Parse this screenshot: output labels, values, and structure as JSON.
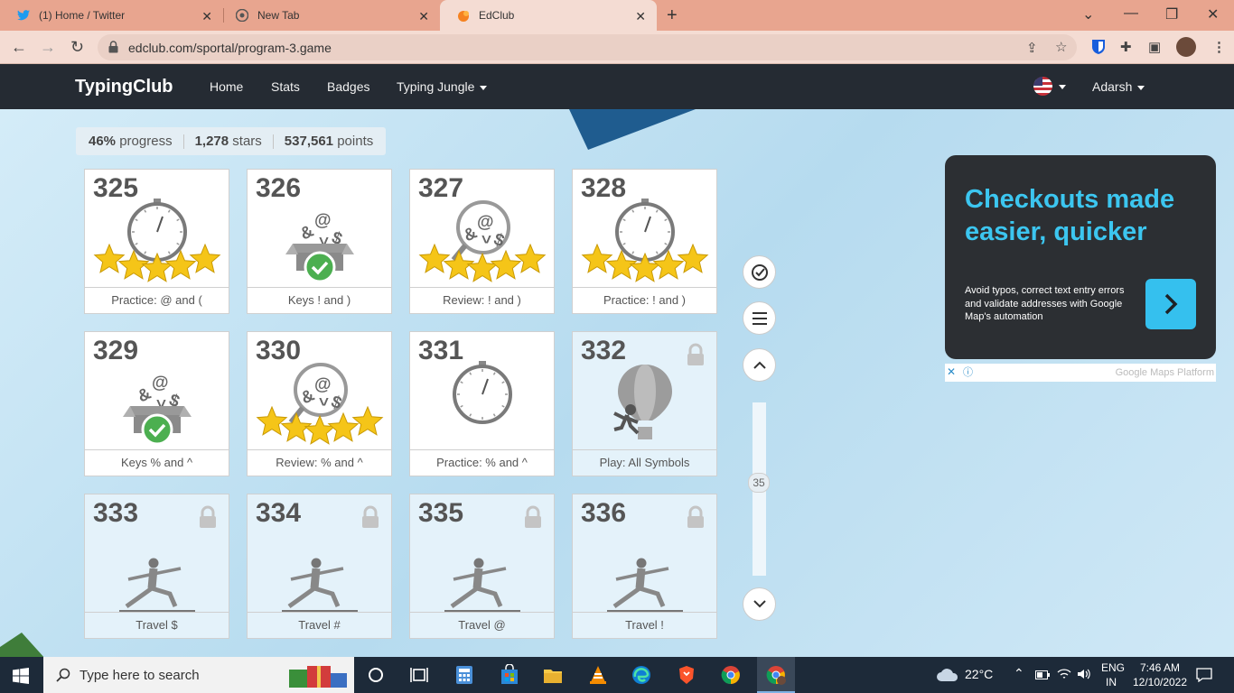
{
  "browser": {
    "tabs": [
      {
        "title": "(1) Home / Twitter",
        "icon": "twitter-icon"
      },
      {
        "title": "New Tab",
        "icon": "chrome-icon"
      },
      {
        "title": "EdClub",
        "icon": "edclub-icon"
      }
    ],
    "url": "edclub.com/sportal/program-3.game"
  },
  "site_nav": {
    "logo": "TypingClub",
    "links": [
      "Home",
      "Stats",
      "Badges",
      "Typing Jungle"
    ],
    "user": "Adarsh"
  },
  "progress": {
    "percent": "46%",
    "percent_label": "progress",
    "stars": "1,278",
    "stars_label": "stars",
    "points": "537,561",
    "points_label": "points"
  },
  "lessons": [
    {
      "num": "325",
      "title": "Practice: @ and (",
      "type": "timer",
      "stars": 5,
      "locked": false
    },
    {
      "num": "326",
      "title": "Keys ! and )",
      "type": "box",
      "stars": 0,
      "locked": false
    },
    {
      "num": "327",
      "title": "Review: ! and )",
      "type": "magnifier",
      "stars": 5,
      "locked": false
    },
    {
      "num": "328",
      "title": "Practice: ! and )",
      "type": "timer",
      "stars": 5,
      "locked": false
    },
    {
      "num": "329",
      "title": "Keys % and ^",
      "type": "box",
      "stars": 0,
      "locked": false
    },
    {
      "num": "330",
      "title": "Review: % and ^",
      "type": "magnifier",
      "stars": 5,
      "locked": false
    },
    {
      "num": "331",
      "title": "Practice: % and ^",
      "type": "timer",
      "stars": 0,
      "locked": false
    },
    {
      "num": "332",
      "title": "Play: All Symbols",
      "type": "balloon",
      "stars": 0,
      "locked": true
    },
    {
      "num": "333",
      "title": "Travel $",
      "type": "yoga",
      "stars": 0,
      "locked": true
    },
    {
      "num": "334",
      "title": "Travel #",
      "type": "yoga",
      "stars": 0,
      "locked": true
    },
    {
      "num": "335",
      "title": "Travel @",
      "type": "yoga",
      "stars": 0,
      "locked": true
    },
    {
      "num": "336",
      "title": "Travel !",
      "type": "yoga",
      "stars": 0,
      "locked": true
    }
  ],
  "symbol_glyphs": "&@^$",
  "scroll": {
    "value": "35"
  },
  "ad": {
    "headline": "Checkouts made easier, quicker",
    "body": "Avoid typos, correct text entry errors and validate addresses with Google Map's automation",
    "sponsor": "Google Maps Platform"
  },
  "taskbar": {
    "search_placeholder": "Type here to search",
    "weather": "22°C",
    "lang_top": "ENG",
    "lang_bottom": "IN",
    "time": "7:46 AM",
    "date": "12/10/2022"
  },
  "colors": {
    "accent": "#3cc6f0",
    "nav_bg": "#252b33",
    "tab_bg": "#e8a58f",
    "star": "#f5c518",
    "check": "#4caf50"
  }
}
